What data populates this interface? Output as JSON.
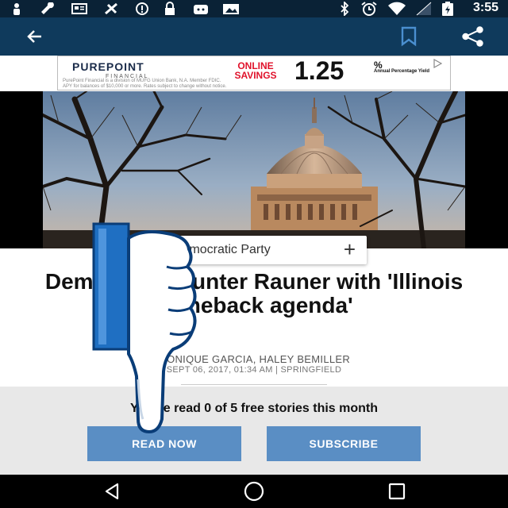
{
  "status_bar": {
    "time": "3:55",
    "left_icons": [
      "person-icon",
      "wrench-icon",
      "news-icon",
      "fan-icon",
      "alert-icon",
      "lock-icon",
      "android-icon",
      "photo-icon"
    ],
    "right_icons": [
      "bluetooth-icon",
      "alarm-icon",
      "wifi-icon",
      "signal-icon",
      "battery-icon"
    ]
  },
  "app_bar": {
    "icons": [
      "back-arrow-icon",
      "bookmark-icon",
      "share-icon"
    ]
  },
  "ad": {
    "brand": "PUREPOINT",
    "brand_sub": "FINANCIAL",
    "offer_line1": "ONLINE",
    "offer_line2": "SAVINGS",
    "rate": "1.25",
    "rate_unit": "%",
    "rate_label": "Annual Percentage Yield",
    "fine_print_1": "PurePoint Financial is a division of MUFG Union Bank, N.A. Member FDIC.",
    "fine_print_2": "APY for balances of $10,000 or more. Rates subject to change without notice."
  },
  "tag": {
    "label": "Democratic Party",
    "add_symbol": "+"
  },
  "article": {
    "headline": "Democrats counter Rauner with 'Illinois comeback agenda'",
    "byline": "MONIQUE GARCIA, HALEY BEMILLER",
    "dateline": "SEPT 06, 2017, 01:34 AM | SPRINGFIELD"
  },
  "paywall": {
    "message": "You've read 0 of 5 free stories this month",
    "read_now_label": "READ NOW",
    "subscribe_label": "SUBSCRIBE"
  },
  "nav_bar": {
    "icons": [
      "back-triangle-icon",
      "home-circle-icon",
      "recents-square-icon"
    ]
  },
  "overlay": {
    "icon": "thumbs-down-icon",
    "colors": {
      "blue": "#1f6fc2",
      "white": "#ffffff",
      "outline": "#0a3d78"
    }
  },
  "colors": {
    "status_bar": "#0a2236",
    "app_bar": "#0f3a5c",
    "button": "#5a8ec4",
    "paywall_bg": "#e8e8e8",
    "ad_red": "#e0122b"
  }
}
